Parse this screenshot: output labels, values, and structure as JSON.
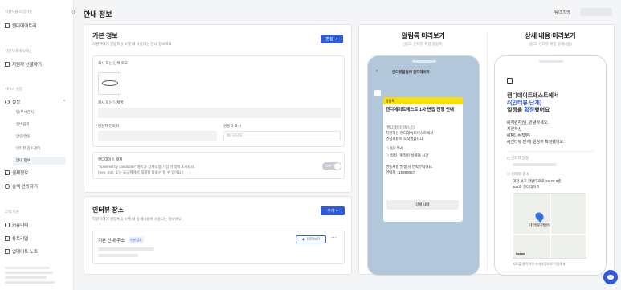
{
  "sidebar": {
    "sec1": "지원자를 모집하는",
    "item1": "캔디데이트리",
    "sec2": "지원자에게 보내는",
    "item2": "지원자 선물하기",
    "sec3": "서비스 설정",
    "item3": "설정",
    "subs": [
      "팀/부서관리",
      "멤버관리",
      "알림/연동",
      "인터뷰 장소관리",
      "안내 정보"
    ],
    "item4": "결제정보",
    "item5": "슬랙 연동하기",
    "sec4": "고객 지원",
    "item6": "커뮤니티",
    "item7": "튜토리얼",
    "item8": "업데이트 노트"
  },
  "header": {
    "title": "안내 정보",
    "right_label": "팀/조직명"
  },
  "basic": {
    "title": "기본 정보",
    "desc": "지원자에게 알림톡을 보낼 때 사용하는 안내 정보에요",
    "edit": "편집",
    "logo_label": "회사 또는 단체 로고",
    "name_label": "회사 또는 단체명",
    "contact_label": "담당자 연락처",
    "manager_label": "담당자 표시",
    "manager_ph": "예) 담당자",
    "badge_title": "캔디데이트 배지",
    "badge_desc1": "\"powered by candidate\" 배지가 상세내용 가장 아래에 표시돼요.",
    "badge_desc2": "(free, trial, 또는 요금제에서 해제할 따로서 할 수 있어요.)",
    "toggle": "ON"
  },
  "interview": {
    "title": "인터뷰 장소",
    "desc": "지원자에게 알림톡을 보낼 때 상세내용에 사용되는 정보에요",
    "add": "추가 +",
    "addr_label": "기본 안내 주소",
    "tag": "기본장소",
    "preview_btn": "미리보기"
  },
  "alim": {
    "title": "알림톡 미리보기",
    "sub": "(링크: 인터뷰 확정 알림톡)",
    "sender": "인터뷰알림이 캔디데이트",
    "tag": "알림톡",
    "msg_title": "캔디데이트테스트 1차 면접 진행 안내",
    "lines": [
      "[캔디데이트테스트]",
      "지원하신 캔디데이트테스트에서",
      "면접사항이 도착했습니다.",
      "▷ 팀 / 부서",
      "▷ 일정 : 확정된 날짜와 시간",
      "변동사항 발생 시 연락부탁해요.",
      "연락처 : 18889057"
    ],
    "btn": "상세 내용"
  },
  "detail": {
    "title": "상세 내용 미리보기",
    "sub": "(링크: 인터뷰 확정 상세내용)",
    "h_black": "캔디데이트테스트에서",
    "h_blue": "#{인터뷰 단계}",
    "h_line3a": "일정을 ",
    "h_line3b": "확정",
    "h_line3c": "했어요",
    "p": [
      "#{지원자}님, 안녕하세요.",
      "지원하신",
      "#{팀}, #{직무}",
      "#{인터뷰 단계} 일정이 확정됐어요."
    ],
    "l1": "인터뷰 일정",
    "l2": "인터뷰 장소",
    "addr1": "대전 서구 한밭대로로 15-20 5층",
    "addr2": "501호 캔디데이트",
    "map_label": "대전한밭지원센터",
    "map_brand": "kakao",
    "note": "지도를 클릭하면 카카오맵으로 이동해요."
  }
}
